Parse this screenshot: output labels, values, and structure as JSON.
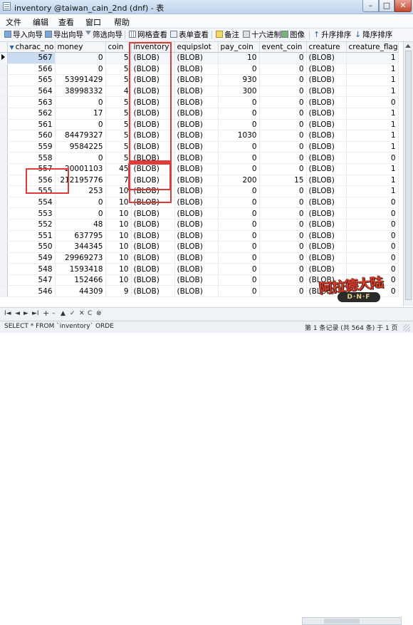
{
  "window": {
    "title": "inventory @taiwan_cain_2nd (dnf) - 表",
    "min_label": "–",
    "max_label": "□",
    "close_label": "✕"
  },
  "menu": [
    "文件",
    "编辑",
    "查看",
    "窗口",
    "帮助"
  ],
  "toolbar": {
    "import": "导入向导",
    "export": "导出向导",
    "filter": "筛选向导",
    "grid_view": "网格查看",
    "form_view": "表单查看",
    "note": "备注",
    "hex": "十六进制",
    "image": "图像",
    "sort_asc": "升序排序",
    "sort_desc": "降序排序"
  },
  "table": {
    "columns": [
      "charac_no",
      "money",
      "coin",
      "inventory",
      "equipslot",
      "pay_coin",
      "event_coin",
      "creature",
      "creature_flag"
    ],
    "rows": [
      [
        "567",
        "0",
        "5",
        "(BLOB)",
        "(BLOB)",
        "10",
        "0",
        "(BLOB)",
        "1"
      ],
      [
        "566",
        "0",
        "5",
        "(BLOB)",
        "(BLOB)",
        "0",
        "0",
        "(BLOB)",
        "1"
      ],
      [
        "565",
        "53991429",
        "5",
        "(BLOB)",
        "(BLOB)",
        "930",
        "0",
        "(BLOB)",
        "1"
      ],
      [
        "564",
        "38998332",
        "4",
        "(BLOB)",
        "(BLOB)",
        "300",
        "0",
        "(BLOB)",
        "1"
      ],
      [
        "563",
        "0",
        "5",
        "(BLOB)",
        "(BLOB)",
        "0",
        "0",
        "(BLOB)",
        "0"
      ],
      [
        "562",
        "17",
        "5",
        "(BLOB)",
        "(BLOB)",
        "0",
        "0",
        "(BLOB)",
        "1"
      ],
      [
        "561",
        "0",
        "5",
        "(BLOB)",
        "(BLOB)",
        "0",
        "0",
        "(BLOB)",
        "1"
      ],
      [
        "560",
        "84479327",
        "5",
        "(BLOB)",
        "(BLOB)",
        "1030",
        "0",
        "(BLOB)",
        "1"
      ],
      [
        "559",
        "9584225",
        "5",
        "(BLOB)",
        "(BLOB)",
        "0",
        "0",
        "(BLOB)",
        "1"
      ],
      [
        "558",
        "0",
        "5",
        "(BLOB)",
        "(BLOB)",
        "0",
        "0",
        "(BLOB)",
        "0"
      ],
      [
        "557",
        "20001103",
        "45",
        "(BLOB)",
        "(BLOB)",
        "0",
        "0",
        "(BLOB)",
        "1"
      ],
      [
        "556",
        "212195776",
        "7",
        "(BLOB)",
        "(BLOB)",
        "200",
        "15",
        "(BLOB)",
        "1"
      ],
      [
        "555",
        "253",
        "10",
        "(BLOB)",
        "(BLOB)",
        "0",
        "0",
        "(BLOB)",
        "1"
      ],
      [
        "554",
        "0",
        "10",
        "(BLOB)",
        "(BLOB)",
        "0",
        "0",
        "(BLOB)",
        "0"
      ],
      [
        "553",
        "0",
        "10",
        "(BLOB)",
        "(BLOB)",
        "0",
        "0",
        "(BLOB)",
        "0"
      ],
      [
        "552",
        "48",
        "10",
        "(BLOB)",
        "(BLOB)",
        "0",
        "0",
        "(BLOB)",
        "0"
      ],
      [
        "551",
        "637795",
        "10",
        "(BLOB)",
        "(BLOB)",
        "0",
        "0",
        "(BLOB)",
        "0"
      ],
      [
        "550",
        "344345",
        "10",
        "(BLOB)",
        "(BLOB)",
        "0",
        "0",
        "(BLOB)",
        "0"
      ],
      [
        "549",
        "29969273",
        "10",
        "(BLOB)",
        "(BLOB)",
        "0",
        "0",
        "(BLOB)",
        "0"
      ],
      [
        "548",
        "1593418",
        "10",
        "(BLOB)",
        "(BLOB)",
        "0",
        "0",
        "(BLOB)",
        "0"
      ],
      [
        "547",
        "152466",
        "10",
        "(BLOB)",
        "(BLOB)",
        "0",
        "0",
        "(BLOB)",
        "0"
      ],
      [
        "546",
        "44309",
        "9",
        "(BLOB)",
        "(BLOB)",
        "0",
        "0",
        "(BLOB)",
        "0"
      ]
    ],
    "selected_row": 0
  },
  "nav": {
    "first": "I◄",
    "prev": "◄",
    "next": "►",
    "last": "►I",
    "add": "+",
    "remove": "–",
    "up": "▲",
    "save": "✓",
    "cancel": "✕",
    "refresh": "C",
    "stop": "⊗"
  },
  "logo": {
    "text": "阿拉德大陆",
    "sub": "D·N·F"
  },
  "status": {
    "sql": "SELECT * FROM `inventory` ORDE",
    "records": "第 1 条记录 (共 564 条) 于 1 页"
  }
}
